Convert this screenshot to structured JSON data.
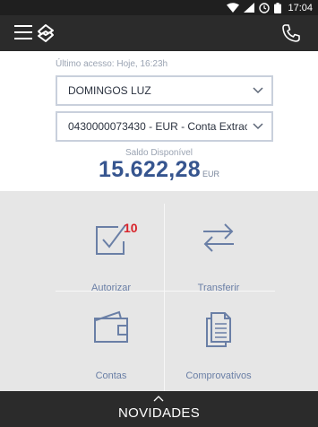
{
  "status_bar": {
    "time": "17:04"
  },
  "header": {
    "menu_icon": "menu-icon",
    "logo_icon": "bank-logo-icon",
    "phone_icon": "phone-icon"
  },
  "account": {
    "last_access": "Último acesso: Hoje, 16:23h",
    "client": "DOMINGOS LUZ",
    "account_selected": "0430000073430 - EUR - Conta Extrac...",
    "balance_label": "Saldo Disponível",
    "balance_amount": "15.622,28",
    "balance_currency": "EUR"
  },
  "tiles": [
    {
      "label": "Autorizar",
      "icon": "authorize-check-icon",
      "badge": "10"
    },
    {
      "label": "Transferir",
      "icon": "transfer-arrows-icon"
    },
    {
      "label": "Contas",
      "icon": "wallet-icon"
    },
    {
      "label": "Comprovativos",
      "icon": "documents-icon"
    }
  ],
  "bottom": {
    "label": "NOVIDADES"
  },
  "colors": {
    "accent": "#36558f",
    "icon": "#6a7fa6",
    "badge": "#d8232a",
    "dark_bar": "#2b2b2b"
  }
}
